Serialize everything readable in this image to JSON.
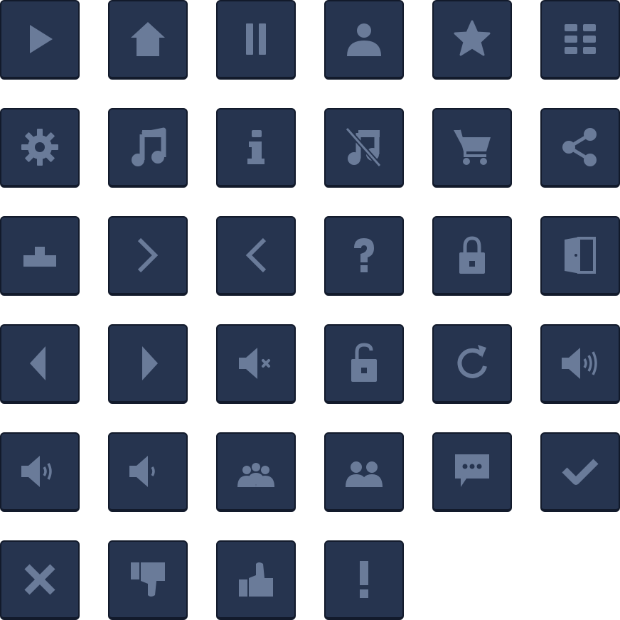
{
  "colors": {
    "tile": "#26344f",
    "border": "#121a2b",
    "icon": "#6a7b99"
  },
  "icons": [
    [
      "play-icon",
      "home-icon",
      "pause-icon",
      "user-icon",
      "star-icon",
      "grid-menu-icon"
    ],
    [
      "gear-icon",
      "music-icon",
      "info-icon",
      "music-off-icon",
      "cart-icon",
      "share-icon"
    ],
    [
      "leaderboard-icon",
      "chevron-right-icon",
      "chevron-left-icon",
      "question-icon",
      "lock-icon",
      "exit-door-icon"
    ],
    [
      "arrow-left-icon",
      "arrow-right-icon",
      "volume-mute-icon",
      "unlock-icon",
      "restart-icon",
      "volume-high-icon"
    ],
    [
      "volume-medium-icon",
      "volume-low-icon",
      "group-icon",
      "multiplayer-icon",
      "chat-icon",
      "checkmark-icon"
    ],
    [
      "close-icon",
      "thumbs-down-icon",
      "thumbs-up-icon",
      "exclamation-icon"
    ]
  ]
}
